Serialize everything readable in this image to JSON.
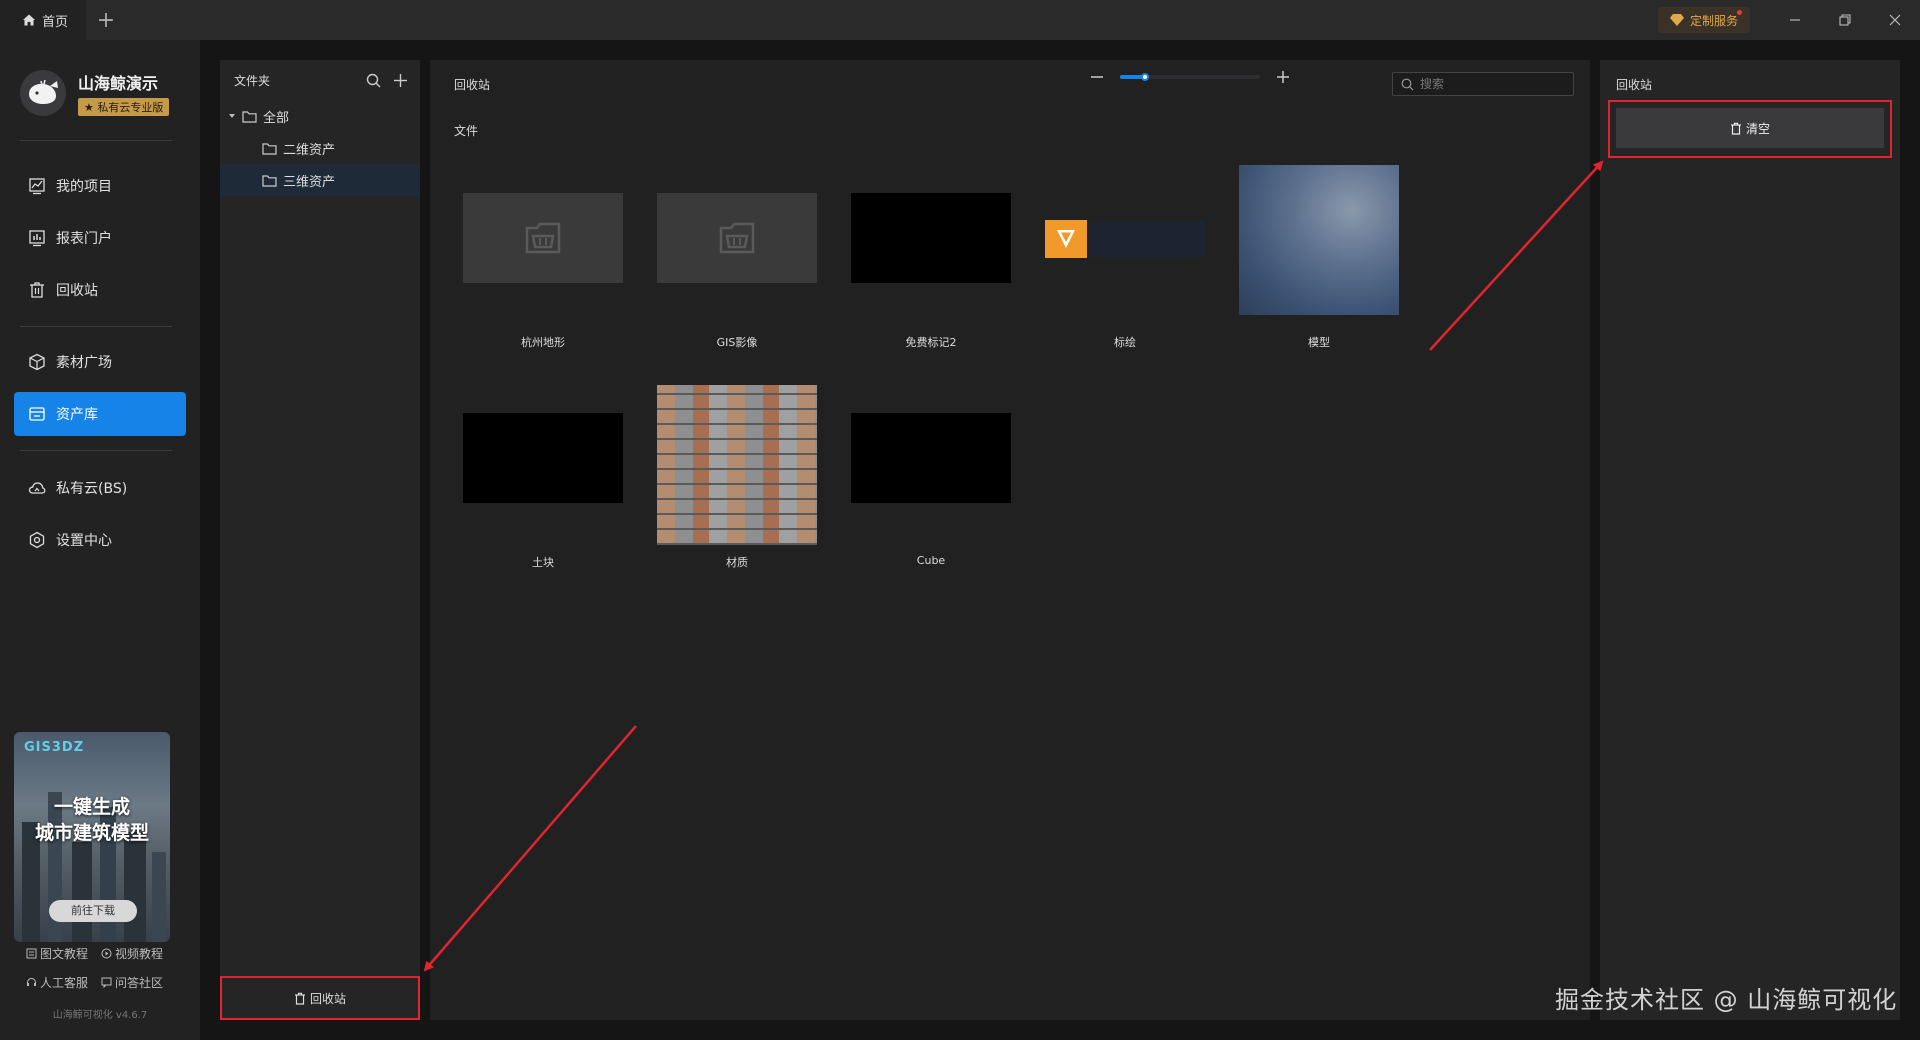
{
  "titlebar": {
    "home_tab": "首页",
    "add_tab": "+",
    "service_button": "定制服务"
  },
  "sidebar": {
    "brand_name": "山海鲸演示",
    "brand_badge": "★ 私有云专业版",
    "nav": [
      {
        "label": "我的项目",
        "icon": "chart-line-icon"
      },
      {
        "label": "报表门户",
        "icon": "report-icon"
      },
      {
        "label": "回收站",
        "icon": "trash-icon"
      },
      {
        "label": "素材广场",
        "icon": "cube-icon"
      },
      {
        "label": "资产库",
        "icon": "asset-icon",
        "active": true
      },
      {
        "label": "私有云(BS)",
        "icon": "cloud-icon"
      },
      {
        "label": "设置中心",
        "icon": "settings-icon"
      }
    ],
    "promo": {
      "brand": "GIS3DZ",
      "title_line1": "一键生成",
      "title_line2": "城市建筑模型",
      "button": "前往下载"
    },
    "help_links": [
      "图文教程",
      "视频教程",
      "人工客服",
      "问答社区"
    ],
    "version": "山海鲸可视化 v4.6.7"
  },
  "folder_panel": {
    "title": "文件夹",
    "tree": [
      {
        "label": "全部",
        "level": 0,
        "expanded": true
      },
      {
        "label": "二维资产",
        "level": 1
      },
      {
        "label": "三维资产",
        "level": 1,
        "selected": true
      }
    ],
    "recycle_button": "回收站"
  },
  "main": {
    "title": "回收站",
    "section": "文件",
    "zoom_level": 0.18,
    "search_placeholder": "搜索",
    "items": [
      {
        "label": "杭州地形",
        "thumb": "folder"
      },
      {
        "label": "GIS影像",
        "thumb": "folder"
      },
      {
        "label": "免费标记2",
        "thumb": "black"
      },
      {
        "label": "标绘",
        "thumb": "marker"
      },
      {
        "label": "模型",
        "thumb": "water"
      },
      {
        "label": "土块",
        "thumb": "black"
      },
      {
        "label": "材质",
        "thumb": "brick"
      },
      {
        "label": "Cube",
        "thumb": "black"
      }
    ]
  },
  "right_panel": {
    "title": "回收站",
    "clear_button": "清空"
  },
  "watermark": "掘金技术社区 @ 山海鲸可视化",
  "colors": {
    "accent": "#1583e8",
    "annotation": "#e0252e",
    "badge": "#c59a4a"
  }
}
